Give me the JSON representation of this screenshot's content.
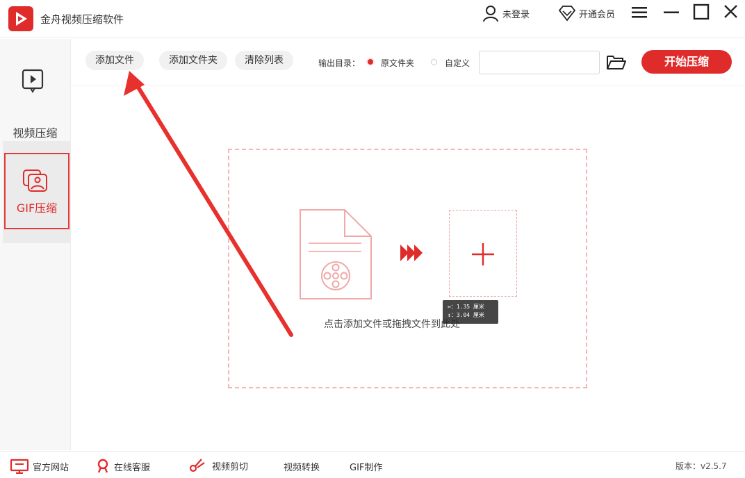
{
  "app": {
    "title": "金舟视频压缩软件",
    "brand_color": "#e02b2b"
  },
  "header": {
    "login_label": "未登录",
    "vip_label": "开通会员",
    "icons": [
      "user-icon",
      "diamond-icon",
      "menu-icon",
      "minimize-icon",
      "maximize-icon",
      "close-icon"
    ]
  },
  "sidebar": {
    "items": [
      {
        "label": "视频压缩",
        "icon": "video-play-icon",
        "selected": false
      },
      {
        "label": "GIF压缩",
        "icon": "gif-image-icon",
        "selected": true
      }
    ]
  },
  "toolbar": {
    "add_file": "添加文件",
    "add_folder": "添加文件夹",
    "clear_list": "清除列表",
    "output_label": "输出目录：",
    "option_source": "原文件夹",
    "option_custom": "自定义",
    "selected_option": "原文件夹",
    "path_value": "",
    "start": "开始压缩"
  },
  "dropzone": {
    "hint": "点击添加文件或拖拽文件到此处",
    "measure_width": "1.35 厘米",
    "measure_height": "3.04 厘米"
  },
  "footer": {
    "site": "官方网站",
    "service": "在线客服",
    "clip": "视频剪切",
    "convert": "视频转换",
    "gif": "GIF制作",
    "version": "版本：v2.5.7"
  }
}
